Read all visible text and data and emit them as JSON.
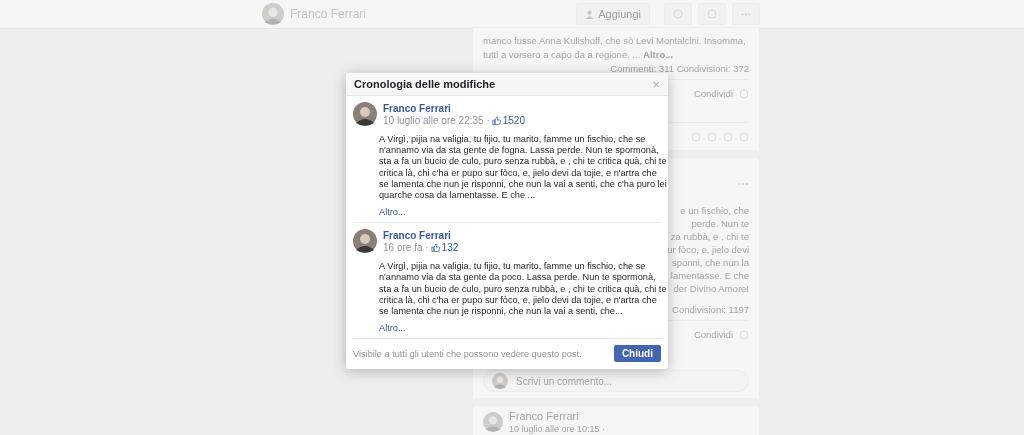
{
  "top_bar": {
    "name": "Franco Ferrari",
    "add_button": "Aggiungi"
  },
  "feed": {
    "posts": [
      {
        "lines": [
          "manco fusse Anna Kulishoff, che sò Levi Montalcini. Insomma,",
          "tutti a vorsero a capo da a regione. ... **Altro...**"
        ],
        "stats": "Commenti: 311  Condivisioni: 372",
        "share": "Condividi"
      },
      {
        "lines": [
          "e un fischio, che",
          "perde. Nun te",
          "za rubbà, e , chi te",
          "ur fòco, e, jielo devi",
          "sponni, che nun la",
          "lamentasse. E che",
          "der Divino Amore!"
        ],
        "stats": "Condivisioni: 1197",
        "share": "Condividi",
        "comment_placeholder": "Scrivi un commento..."
      },
      {
        "author": "Franco Ferrari",
        "time": "10 luglio alle ore 10:15 ·"
      }
    ]
  },
  "dialog": {
    "title": "Cronologia delle modifiche",
    "close": "×",
    "revisions": [
      {
        "author": "Franco Ferrari",
        "time": "10 luglio alle ore 22:35 ·",
        "likes": "1520",
        "text": "A Virgì, pijia na valigia, tu fijio, tu marito, famme un fischio, che se n'annamo via da sta gente de fogna. Lassa perde. Nun te spormonà, sta a fa un bucio de culo, puro senza rubbà, e , chi te critica quà, chi te critica là, chi c'ha er pupo sur fòco, e, jielo devi da tojie, e n'artra che se lamenta che nun je risponni, che nun la vai a senti, che c'ha puro lei quarche cosa da lamentasse. E che ...",
        "more": "Altro..."
      },
      {
        "author": "Franco Ferrari",
        "time": "16 ore fa ·",
        "likes": "132",
        "text": "A Virgì, pijia na valigia, tu fijio, tu marito, famme un fischio, che se n'annamo via da sta gente da poco. Lassa perde. Nun te spormonà, sta a fa un bucio de culo, puro senza rubbà, e , chi te critica quà, chi te critica là, chi c'ha er pupo sur fòco, e, jielo devi da tojie, e n'artra che se lamenta che nun je risponni, che nun la vai a senti, che...",
        "more": "Altro..."
      }
    ],
    "footer_note": "Visibile a tutti gli utenti che possono vedere questo post.",
    "button": "Chiudi"
  }
}
